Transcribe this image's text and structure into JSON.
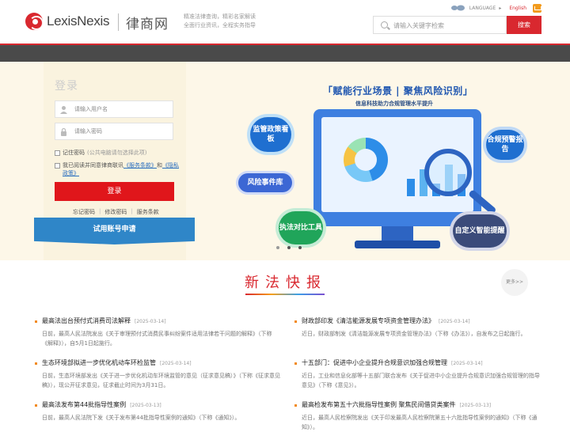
{
  "header": {
    "brand_name": "LexisNexis",
    "brand_cn": "律商网",
    "slogan_line1": "精准法律查询，精彩名家解读",
    "slogan_line2": "全面行业资讯，全程实务指导",
    "language_label": "LANGUAGE",
    "language_en": "English",
    "search_placeholder": "请输入关键字检索",
    "search_button": "搜索"
  },
  "login": {
    "title": "登录",
    "username_placeholder": "请输入用户名",
    "password_placeholder": "请输入密码",
    "remember_label": "记住密码",
    "remember_hint": "(公共电脑请勿选择此项)",
    "agree_prefix": "我已阅读并同意律商联讯",
    "terms_link": "《服务条款》",
    "agree_and": "和",
    "privacy_link": "《隐私政策》",
    "login_button": "登录",
    "forgot_password": "忘记密码",
    "change_password": "修改密码",
    "service_terms": "服务条款",
    "trial_button": "试用账号申请"
  },
  "banner": {
    "title": "「赋能行业场景 | 聚焦风险识别」",
    "subtitle": "信息科技助力合规管理水平提升",
    "bubble_1": "监管政策看板",
    "bubble_2": "风险事件库",
    "bubble_3": "执法对比工具",
    "bubble_4": "合规预警报告",
    "bubble_5": "自定义智能提醒"
  },
  "news": {
    "title": "新法快报",
    "more": "更多>>",
    "items": [
      {
        "title": "最高法出台预付式消费司法解释",
        "date": "[2025-03-14]",
        "summary": "日前，最高人民法院发出《关于审理预付式消费民事纠纷案件适用法律若干问题的解释》（下称《解释》），自5月1日起施行。"
      },
      {
        "title": "财政部印发《清洁能源发展专项资金管理办法》",
        "date": "[2025-03-14]",
        "summary": "近日，财政部制发《清洁能源发展专项资金管理办法》（下称《办法》），自发布之日起施行。"
      },
      {
        "title": "生态环境部拟进一步优化机动车环检监管",
        "date": "[2025-03-14]",
        "summary": "日前，生态环境部发出《关于进一步优化机动车环境监管的意见（征求意见稿）》（下称《征求意见稿》），现公开征求意见，征求截止时间为3月31日。"
      },
      {
        "title": "十五部门：促进中小企业提升合规意识加强合规管理",
        "date": "[2025-03-14]",
        "summary": "近日，工业和信息化部等十五部门联合发布《关于促进中小企业提升合规意识加强合规管理的指导意见》（下称《意见》）。"
      },
      {
        "title": "最高法发布第44批指导性案例",
        "date": "[2025-03-13]",
        "summary": "日前，最高人民法院下发《关于发布第44批指导性案例的通知》（下称《通知》）。"
      },
      {
        "title": "最高检发布第五十六批指导性案例 聚焦民间借贷类案件",
        "date": "[2025-03-13]",
        "summary": "近日，最高人民检察院发出《关于印发最高人民检察院第五十六批指导性案例的通知》（下称《通知》）。"
      }
    ]
  }
}
